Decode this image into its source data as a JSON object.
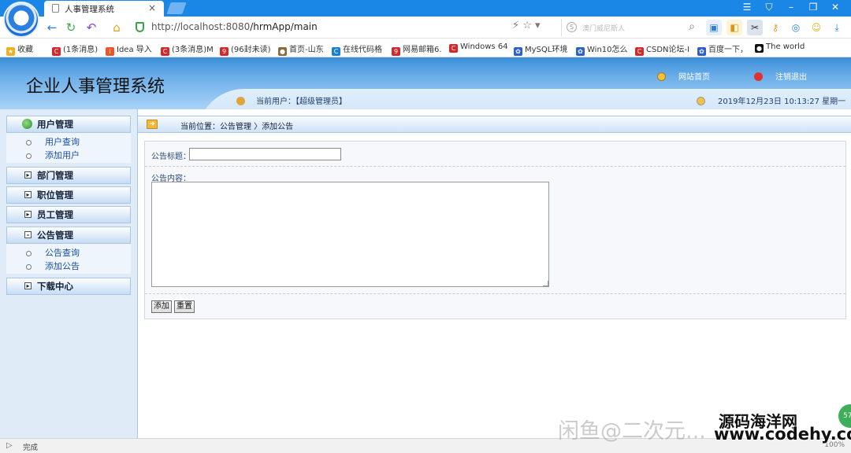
{
  "browser": {
    "tab_title": "人事管理系统",
    "tab_close": "×",
    "url_host": "http://localhost:8080",
    "url_path": "/hrmApp/main",
    "search_placeholder": "澳门威尼斯人",
    "window_controls": [
      "☰",
      "⛉",
      "–",
      "❐",
      "✕"
    ]
  },
  "bookmarks": [
    {
      "label": "收藏",
      "color": "#f2b01e",
      "glyph": "★"
    },
    {
      "label": "(1条消息)",
      "color": "#d12a2a",
      "glyph": "C"
    },
    {
      "label": "Idea 导入",
      "color": "#e8562a",
      "glyph": "i"
    },
    {
      "label": "(3条消息)M",
      "color": "#d12a2a",
      "glyph": "C"
    },
    {
      "label": "(96封未读)",
      "color": "#d12a2a",
      "glyph": "9"
    },
    {
      "label": "首页-山东",
      "color": "#8a6a3a",
      "glyph": "●"
    },
    {
      "label": "在线代码格",
      "color": "#1a7fd4",
      "glyph": "C"
    },
    {
      "label": "网易邮箱6.",
      "color": "#d12a2a",
      "glyph": "9"
    },
    {
      "label": "Windows 64",
      "color": "#d12a2a",
      "glyph": "C"
    },
    {
      "label": "MySQL环境",
      "color": "#2d5fd1",
      "glyph": "✿"
    },
    {
      "label": "Win10怎么",
      "color": "#2d5fd1",
      "glyph": "✿"
    },
    {
      "label": "CSDN论坛-I",
      "color": "#d12a2a",
      "glyph": "C"
    },
    {
      "label": "百度一下，",
      "color": "#2d5fd1",
      "glyph": "✿"
    },
    {
      "label": "The world",
      "color": "#111111",
      "glyph": "●"
    }
  ],
  "header": {
    "app_title": "企业人事管理系统",
    "home_link": "网站首页",
    "logout_link": "注销退出",
    "current_user_label": "当前用户：【超级管理员】",
    "datetime": "2019年12月23日  10:13:27  星期一"
  },
  "sidebar": {
    "groups": [
      {
        "label": "用户管理",
        "items": [
          "用户查询",
          "添加用户"
        ]
      },
      {
        "label": "部门管理"
      },
      {
        "label": "职位管理"
      },
      {
        "label": "员工管理"
      },
      {
        "label": "公告管理",
        "items": [
          "公告查询",
          "添加公告"
        ]
      },
      {
        "label": "下载中心"
      }
    ]
  },
  "main": {
    "location": "当前位置：公告管理 〉添加公告",
    "title_label": "公告标题：",
    "title_value": "",
    "content_label": "公告内容：",
    "content_value": "",
    "add_button": "添加",
    "reset_button": "重置"
  },
  "statusbar": {
    "status_text": "完成",
    "zoom": "100%"
  },
  "watermark": {
    "text": "闲鱼@二次元...",
    "site_name": "源码海洋网",
    "site_url": "www.codehy.com",
    "badge": "57"
  },
  "colors": {
    "browser_blue": "#1a86e6",
    "header_blue": "#3a8fd8",
    "menu_link": "#1b4fa0"
  }
}
